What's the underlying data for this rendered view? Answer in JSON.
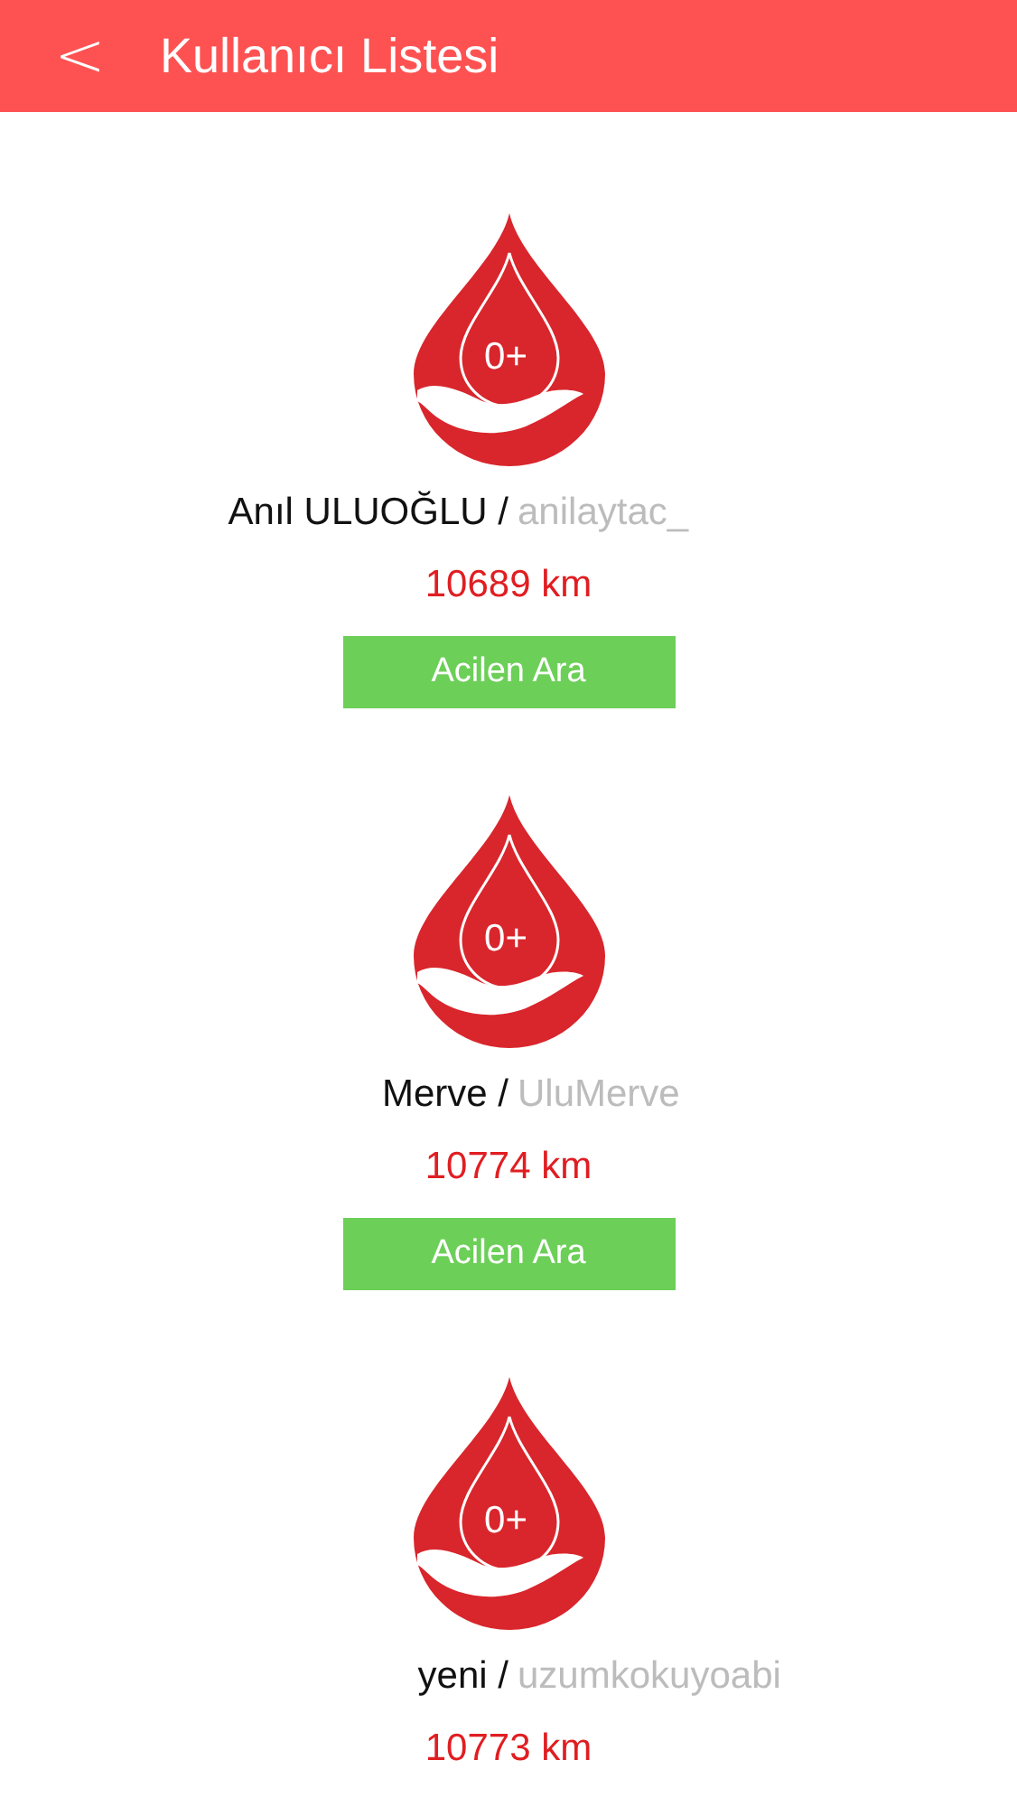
{
  "header": {
    "back": "<",
    "title": "Kullanıcı Listesi"
  },
  "users": [
    {
      "blood_type": "0+",
      "name": "Anıl ULUOĞLU",
      "separator": "/",
      "username": "anilaytac_",
      "distance": "10689 km",
      "button": "Acilen Ara"
    },
    {
      "blood_type": "0+",
      "name": "Merve",
      "separator": "/",
      "username": "UluMerve",
      "distance": "10774 km",
      "button": "Acilen Ara"
    },
    {
      "blood_type": "0+",
      "name": "yeni",
      "separator": "/",
      "username": "uzumkokuyoabi",
      "distance": "10773 km"
    }
  ]
}
